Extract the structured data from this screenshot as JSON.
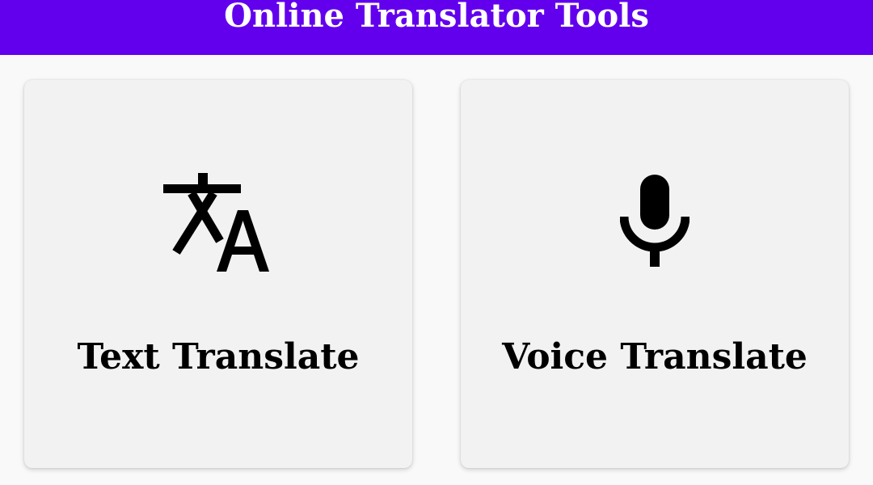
{
  "header": {
    "title": "Online Translator Tools",
    "background_color": "#6200ee"
  },
  "cards": [
    {
      "label": "Text Translate",
      "icon": "translate-icon"
    },
    {
      "label": "Voice Translate",
      "icon": "microphone-icon"
    }
  ],
  "colors": {
    "page_background": "#f9f9f9",
    "card_background": "#f2f2f2",
    "text": "#000000"
  }
}
